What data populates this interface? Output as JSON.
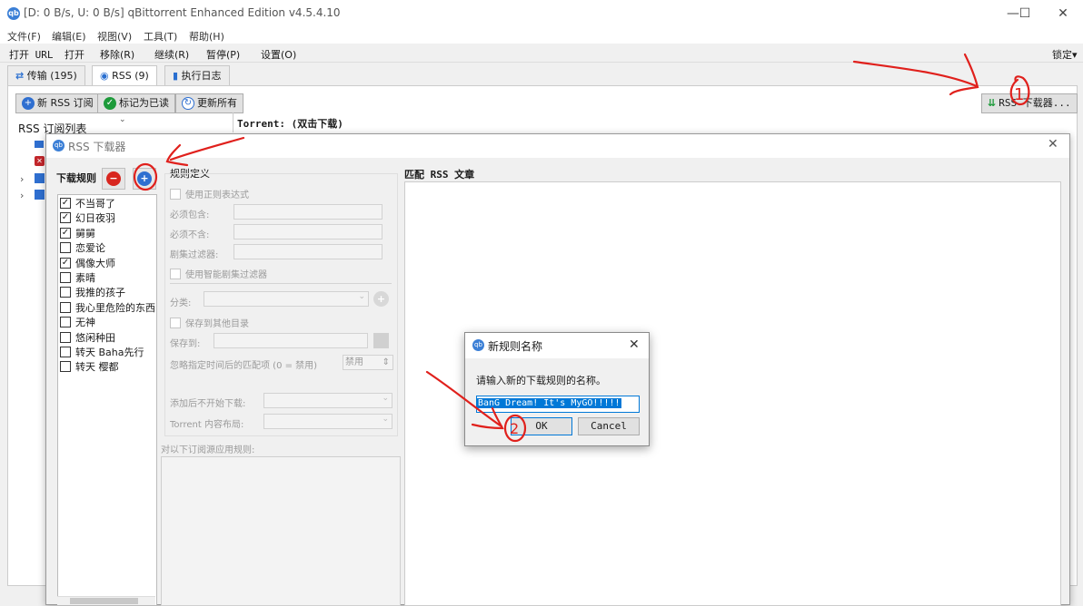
{
  "window": {
    "title": "[D: 0 B/s, U: 0 B/s] qBittorrent Enhanced Edition v4.5.4.10",
    "app_icon": "qb",
    "minimize": "—",
    "maximize": "☐",
    "close": "✕"
  },
  "menu": [
    "文件(F)",
    "编辑(E)",
    "视图(V)",
    "工具(T)",
    "帮助(H)"
  ],
  "toolbar": {
    "items": [
      "打开 URL",
      "打开",
      "移除(R)",
      "继续(R)",
      "暂停(P)",
      "设置(O)"
    ],
    "lock": "锁定▾"
  },
  "tabs": [
    {
      "label": "传输 (195)",
      "icon": "transfer-icon"
    },
    {
      "label": "RSS (9)",
      "icon": "rss-icon"
    },
    {
      "label": "执行日志",
      "icon": "log-book-icon"
    }
  ],
  "rss": {
    "new_sub": "新 RSS 订阅",
    "mark_read": "标记为已读",
    "update_all": "更新所有",
    "feed_list_title": "RSS 订阅列表",
    "torrent_header": "Torrent: (双击下载)",
    "downloader_button": "RSS 下载器..."
  },
  "downloader": {
    "title": "RSS 下载器",
    "rules_label": "下载规则",
    "rules": [
      {
        "name": "不当哥了",
        "checked": true
      },
      {
        "name": "幻日夜羽",
        "checked": true
      },
      {
        "name": "舅舅",
        "checked": true
      },
      {
        "name": "恋爱论",
        "checked": false
      },
      {
        "name": "偶像大师",
        "checked": true
      },
      {
        "name": "素晴",
        "checked": false
      },
      {
        "name": "我推的孩子",
        "checked": false
      },
      {
        "name": "我心里危险的东西",
        "checked": false
      },
      {
        "name": "无神",
        "checked": false
      },
      {
        "name": "悠闲种田",
        "checked": false
      },
      {
        "name": "转天 Baha先行",
        "checked": false
      },
      {
        "name": "转天 樱都",
        "checked": false
      }
    ],
    "rule_def": "规则定义",
    "use_regex": "使用正则表达式",
    "must_contain": "必须包含:",
    "must_not_contain": "必须不含:",
    "episode_filter": "剧集过滤器:",
    "smart_filter": "使用智能剧集过滤器",
    "category": "分类:",
    "save_other": "保存到其他目录",
    "save_to": "保存到:",
    "ignore_after": "忽略指定时间后的匹配项 (0 = 禁用)",
    "ignore_value": "禁用",
    "add_paused": "添加后不开始下载:",
    "content_layout": "Torrent 内容布局:",
    "apply_to": "对以下订阅源应用规则:",
    "match_title": "匹配 RSS 文章"
  },
  "new_rule_dialog": {
    "title": "新规则名称",
    "prompt": "请输入新的下载规则的名称。",
    "value": "BanG Dream! It's MyGO!!!!!",
    "ok": "OK",
    "cancel": "Cancel"
  },
  "annotations": {
    "one": "1",
    "two": "2"
  },
  "colors": {
    "accent": "#0078d7",
    "annotation": "#e0201c",
    "remove": "#d8261f",
    "add": "#2f6fd0",
    "check": "#1d9a3a"
  }
}
